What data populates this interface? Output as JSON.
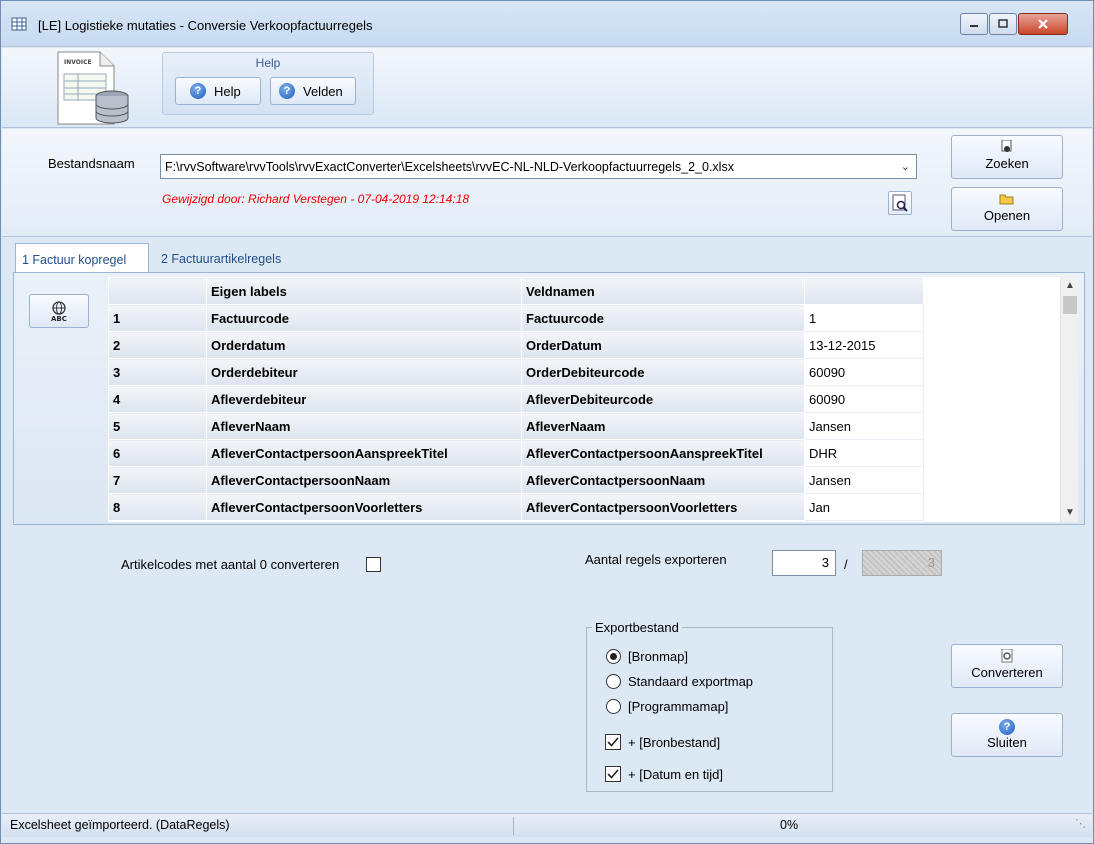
{
  "window": {
    "title": "[LE]  Logistieke mutaties - Conversie Verkoopfactuurregels"
  },
  "ribbon": {
    "group_title": "Help",
    "help_label": "Help",
    "fields_label": "Velden",
    "logo_text": "INVOICE"
  },
  "file": {
    "label": "Bestandsnaam",
    "path": "F:\\rvvSoftware\\rvvTools\\rvvExactConverter\\Excelsheets\\rvvEC-NL-NLD-Verkoopfactuurregels_2_0.xlsx",
    "modified": "Gewijzigd door: Richard Verstegen   -   07-04-2019  12:14:18",
    "search_label": "Zoeken",
    "open_label": "Openen"
  },
  "tabs": [
    {
      "label": "1 Factuur kopregel",
      "active": true
    },
    {
      "label": "2 Factuurartikelregels",
      "active": false
    }
  ],
  "grid": {
    "headers": [
      "",
      "Eigen labels",
      "Veldnamen",
      ""
    ],
    "rows": [
      {
        "nr": "1",
        "label": "Factuurcode",
        "field": "Factuurcode",
        "value": "1"
      },
      {
        "nr": "2",
        "label": "Orderdatum",
        "field": "OrderDatum",
        "value": "13-12-2015"
      },
      {
        "nr": "3",
        "label": "Orderdebiteur",
        "field": "OrderDebiteurcode",
        "value": "60090"
      },
      {
        "nr": "4",
        "label": "Afleverdebiteur",
        "field": "AfleverDebiteurcode",
        "value": "60090"
      },
      {
        "nr": "5",
        "label": "AfleverNaam",
        "field": "AfleverNaam",
        "value": "Jansen"
      },
      {
        "nr": "6",
        "label": "AfleverContactpersoonAanspreekTitel",
        "field": "AfleverContactpersoonAanspreekTitel",
        "value": "DHR"
      },
      {
        "nr": "7",
        "label": "AfleverContactpersoonNaam",
        "field": "AfleverContactpersoonNaam",
        "value": "Jansen"
      },
      {
        "nr": "8",
        "label": "AfleverContactpersoonVoorletters",
        "field": "AfleverContactpersoonVoorletters",
        "value": "Jan"
      }
    ]
  },
  "options": {
    "zero_qty_label": "Artikelcodes met aantal 0 converteren",
    "zero_qty_checked": false,
    "export_rows_label": "Aantal regels exporteren",
    "export_rows_value": "3",
    "separator": "/",
    "total_rows": "3"
  },
  "export": {
    "legend": "Exportbestand",
    "options": [
      "[Bronmap]",
      "Standaard exportmap",
      "[Programmamap]"
    ],
    "selected": 0,
    "checks": [
      {
        "label": "+ [Bronbestand]",
        "checked": true
      },
      {
        "label": "+ [Datum en tijd]",
        "checked": true
      }
    ]
  },
  "actions": {
    "convert_label": "Converteren",
    "close_label": "Sluiten"
  },
  "status": {
    "message": "Excelsheet geïmporteerd. (DataRegels)",
    "progress": "0%"
  }
}
